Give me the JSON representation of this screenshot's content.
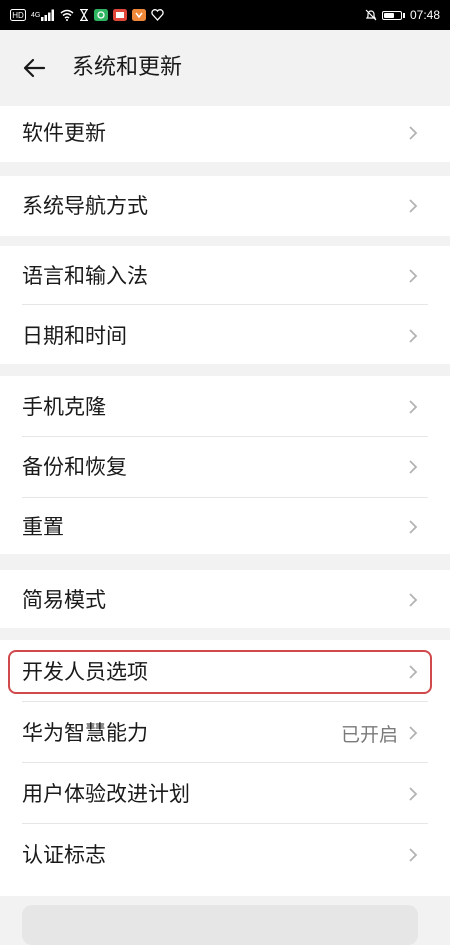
{
  "statusbar": {
    "left_icons": [
      "hd-icon",
      "signal-icon",
      "wifi-icon",
      "hourglass-icon",
      "app-green-icon",
      "app-red-icon",
      "app-orange-icon",
      "heart-icon"
    ],
    "signal_label": "4G",
    "time": "07:48",
    "battery_level": 0.7
  },
  "header": {
    "title": "系统和更新"
  },
  "items": [
    {
      "label": "软件更新",
      "value": ""
    },
    {
      "label": "系统导航方式",
      "value": ""
    },
    {
      "label": "语言和输入法",
      "value": ""
    },
    {
      "label": "日期和时间",
      "value": ""
    },
    {
      "label": "手机克隆",
      "value": ""
    },
    {
      "label": "备份和恢复",
      "value": ""
    },
    {
      "label": "重置",
      "value": ""
    },
    {
      "label": "简易模式",
      "value": ""
    },
    {
      "label": "开发人员选项",
      "value": ""
    },
    {
      "label": "华为智慧能力",
      "value": "已开启"
    },
    {
      "label": "用户体验改进计划",
      "value": ""
    },
    {
      "label": "认证标志",
      "value": ""
    }
  ],
  "colors": {
    "highlight": "#d0494c",
    "background": "#f2f2f2",
    "card": "#ffffff"
  }
}
